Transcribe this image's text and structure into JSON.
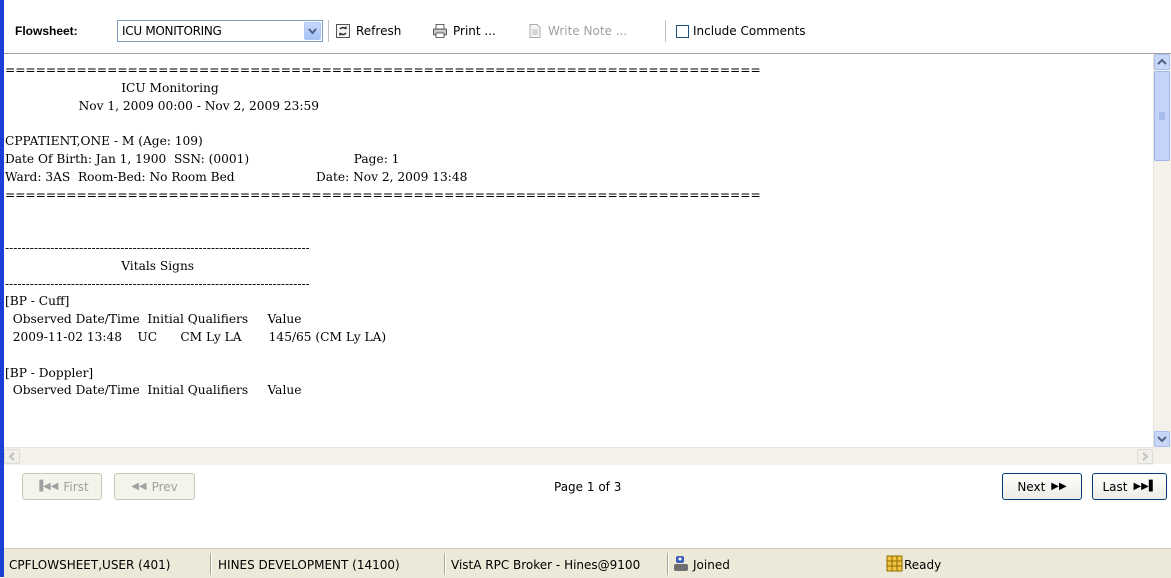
{
  "toolbar": {
    "flowsheet_label": "Flowsheet:",
    "flowsheet_value": "ICU MONITORING",
    "refresh_label": "Refresh",
    "print_label": "Print ...",
    "write_note_label": "Write Note ...",
    "include_comments_label": "Include Comments",
    "include_comments_checked": false
  },
  "report": {
    "lines": [
      "==========================================================================",
      "                              ICU Monitoring",
      "                   Nov 1, 2009 00:00 - Nov 2, 2009 23:59",
      "",
      "CPPATIENT,ONE - M (Age: 109)",
      "Date Of Birth: Jan 1, 1900  SSN: (0001)                           Page: 1",
      "Ward: 3AS  Room-Bed: No Room Bed                     Date: Nov 2, 2009 13:48",
      "==========================================================================",
      "",
      "",
      "--------------------------------------------------------------------------",
      "                              Vitals Signs",
      "--------------------------------------------------------------------------",
      "[BP - Cuff]",
      "  Observed Date/Time  Initial Qualifiers     Value",
      "  2009-11-02 13:48    UC      CM Ly LA       145/65 (CM Ly LA)",
      "",
      "[BP - Doppler]",
      "  Observed Date/Time  Initial Qualifiers     Value"
    ]
  },
  "pager": {
    "first_label": "First",
    "prev_label": "Prev",
    "page_indicator": "Page 1 of 3",
    "next_label": "Next",
    "last_label": "Last"
  },
  "statusbar": {
    "user": "CPFLOWSHEET,USER (401)",
    "division": "HINES DEVELOPMENT (14100)",
    "broker": "VistA RPC Broker - Hines@9100",
    "connection": "Joined",
    "state": "Ready"
  },
  "colors": {
    "accent": "#1a3fd6",
    "statusbar_bg": "#ece9d8",
    "button_border": "#003c74"
  }
}
